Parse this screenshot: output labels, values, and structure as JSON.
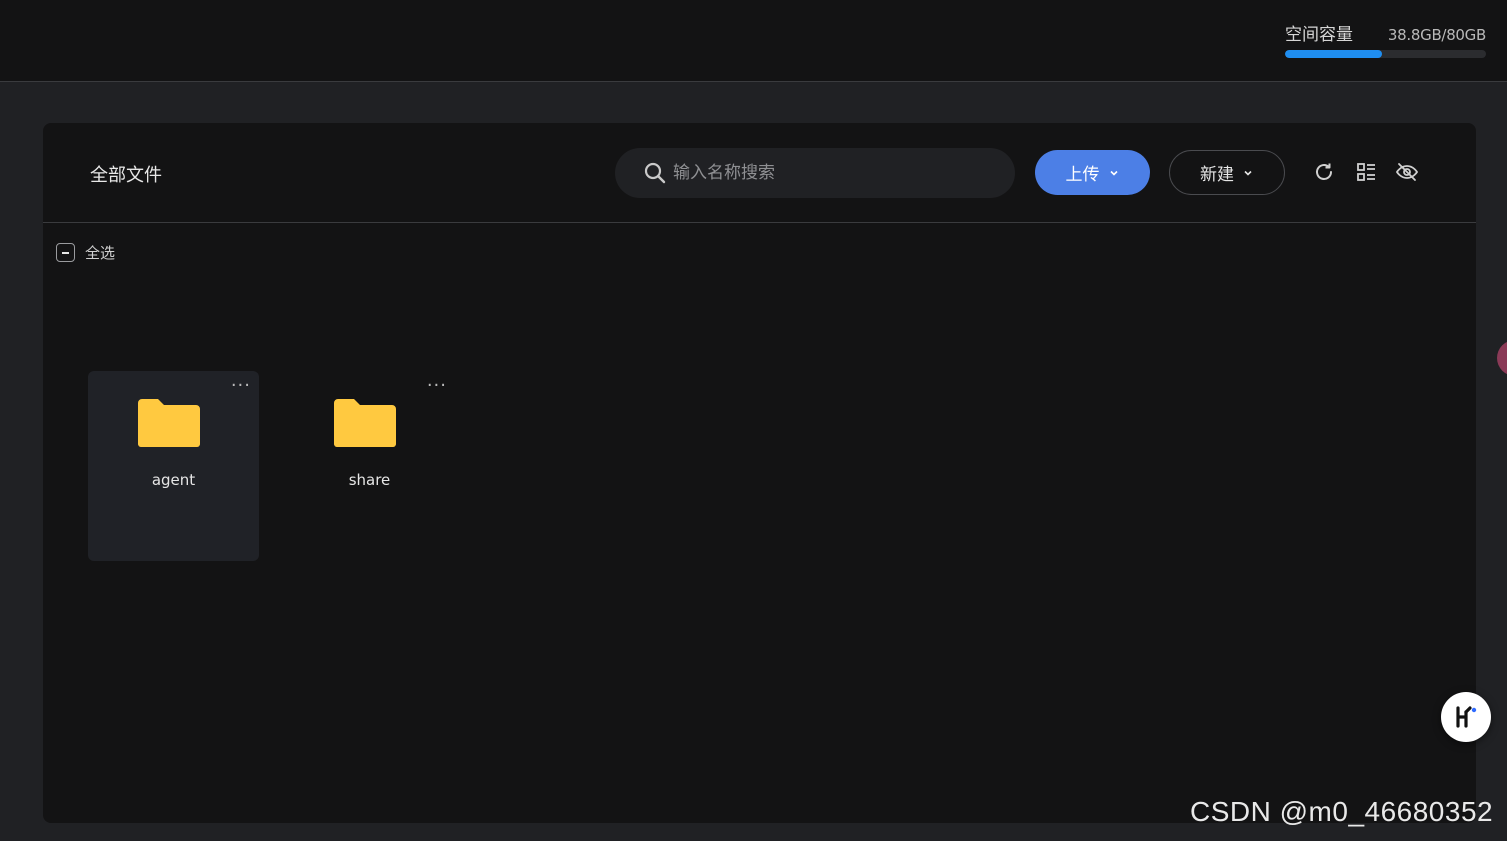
{
  "storage": {
    "label": "空间容量",
    "value": "38.8GB/80GB",
    "used_fraction": 0.485,
    "bar_color": "#1f8ef1"
  },
  "header": {
    "breadcrumb": "全部文件",
    "search_placeholder": "输入名称搜索",
    "upload_label": "上传",
    "new_label": "新建",
    "tools": [
      "refresh-icon",
      "view-toggle-icon",
      "hide-icon"
    ]
  },
  "selection": {
    "select_all_label": "全选"
  },
  "files": [
    {
      "name": "agent",
      "icon": "folder-icon",
      "active": true
    },
    {
      "name": "share",
      "icon": "folder-icon",
      "active": false
    }
  ],
  "colors": {
    "accent": "#4c7fe6",
    "folder": "#ffc940",
    "background": "#131314"
  },
  "watermark": "CSDN @m0_46680352"
}
